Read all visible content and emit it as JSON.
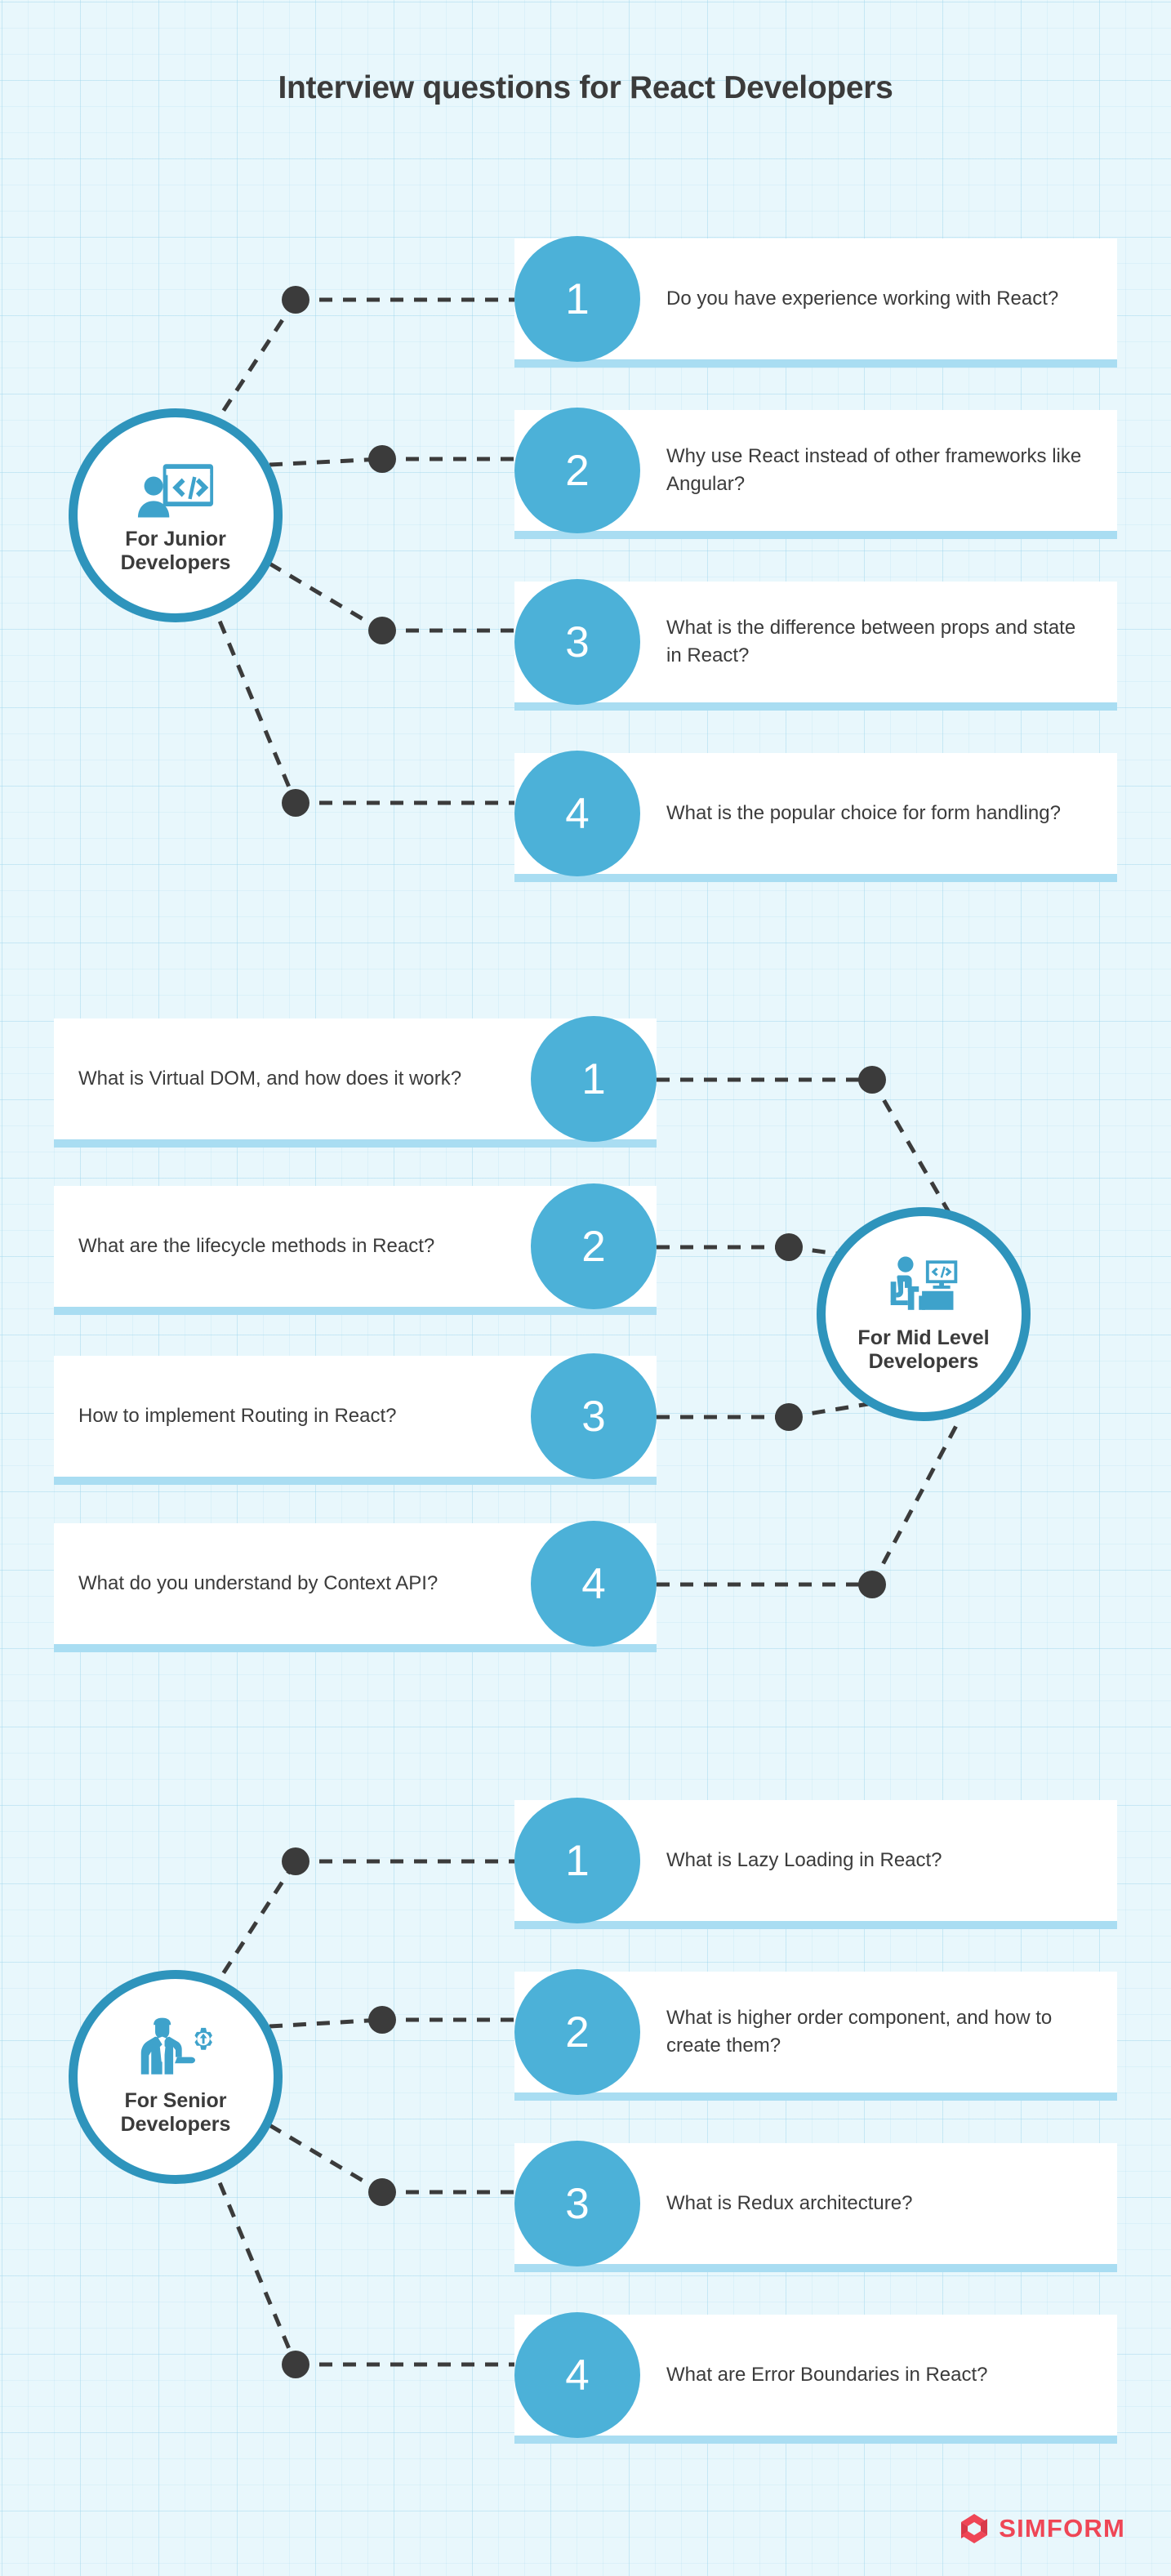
{
  "page": {
    "title": "Interview questions for React Developers",
    "accent_blue": "#4cb1d8",
    "hub_border_blue": "#2e94bc",
    "card_bar_blue": "#a9ddf2",
    "background_blue": "#e8f7fc",
    "text_dark": "#3b3b3b",
    "connector_dark": "#3b3b3b",
    "brand_red": "#ef4656"
  },
  "sections": [
    {
      "id": "junior",
      "hub_label_line1": "For Junior",
      "hub_label_line2": "Developers",
      "hub_icon": "person-with-code-window-icon",
      "side": "right",
      "questions": [
        {
          "number": "1",
          "text": "Do you have experience working with React?"
        },
        {
          "number": "2",
          "text": "Why use React instead of other frameworks like Angular?"
        },
        {
          "number": "3",
          "text": "What is the difference between props and state in React?"
        },
        {
          "number": "4",
          "text": "What is the popular choice for form handling?"
        }
      ]
    },
    {
      "id": "mid",
      "hub_label_line1": "For Mid Level",
      "hub_label_line2": "Developers",
      "hub_icon": "person-at-desk-with-monitor-icon",
      "side": "left",
      "questions": [
        {
          "number": "1",
          "text": "What is Virtual DOM, and how does it work?"
        },
        {
          "number": "2",
          "text": "What are the lifecycle methods in React?"
        },
        {
          "number": "3",
          "text": "How to implement Routing in React?"
        },
        {
          "number": "4",
          "text": "What do you understand by Context API?"
        }
      ]
    },
    {
      "id": "senior",
      "hub_label_line1": "For Senior",
      "hub_label_line2": "Developers",
      "hub_icon": "businessman-with-gear-icon",
      "side": "right",
      "questions": [
        {
          "number": "1",
          "text": "What is Lazy Loading in React?"
        },
        {
          "number": "2",
          "text": "What is higher order component, and how to create them?"
        },
        {
          "number": "3",
          "text": "What is Redux architecture?"
        },
        {
          "number": "4",
          "text": "What are Error Boundaries in React?"
        }
      ]
    }
  ],
  "footer": {
    "brand_name": "SIMFORM",
    "brand_mark": "simform-s-logo-icon"
  }
}
